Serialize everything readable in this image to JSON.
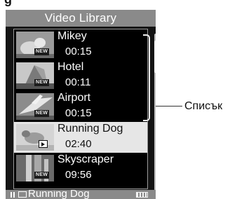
{
  "header": {
    "title": "Video Library"
  },
  "videos": [
    {
      "name": "Mikey",
      "duration": "00:15",
      "badge": "NEW",
      "selected": false
    },
    {
      "name": "Hotel",
      "duration": "00:11",
      "badge": "NEW",
      "selected": false
    },
    {
      "name": "Airport",
      "duration": "00:15",
      "badge": "NEW",
      "selected": false
    },
    {
      "name": "Running Dog",
      "duration": "02:40",
      "badge": "",
      "selected": true
    },
    {
      "name": "Skyscraper",
      "duration": "09:56",
      "badge": "NEW",
      "selected": false
    }
  ],
  "status": {
    "now_playing": "Running Dog",
    "playback_state": "paused"
  },
  "callout": {
    "label": "Списък"
  },
  "colors": {
    "title_bar": "#8a8a8a",
    "list_bg": "#000000",
    "highlight": "#e6e6e6"
  }
}
